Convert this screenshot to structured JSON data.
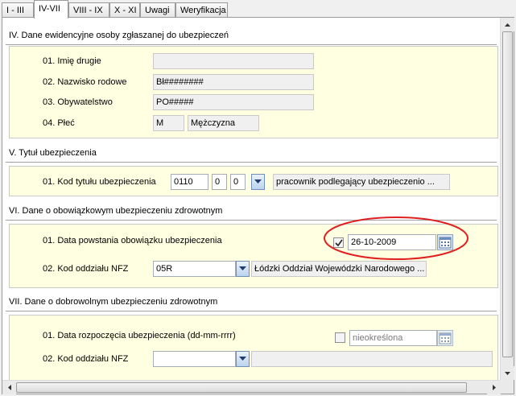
{
  "tabs": [
    "I - III",
    "IV-VII",
    "VIII - IX",
    "X - XI",
    "Uwagi",
    "Weryfikacja"
  ],
  "section4": {
    "title": "IV. Dane ewidencyjne osoby zgłaszanej do ubezpieczeń",
    "imie_label": "01. Imię drugie",
    "imie_value": "",
    "nazwisko_label": "02. Nazwisko rodowe",
    "nazwisko_value": "Bł########",
    "obyw_label": "03. Obywatelstwo",
    "obyw_value": "PO#####",
    "plec_label": "04. Płeć",
    "plec_code": "M",
    "plec_text": "Mężczyzna"
  },
  "section5": {
    "title": "V. Tytuł ubezpieczenia",
    "kod_label": "01. Kod tytułu ubezpieczenia",
    "kod1": "0110",
    "kod2": "0",
    "kod3": "0",
    "kod_desc": "pracownik podlegający ubezpieczenio ..."
  },
  "section6": {
    "title": "VI. Dane o obowiązkowym ubezpieczeniu zdrowotnym",
    "data_label": "01. Data powstania obowiązku ubezpieczenia",
    "data_checked": true,
    "data_value": "26-10-2009",
    "nfz_label": "02. Kod oddziału NFZ",
    "nfz_code": "05R",
    "nfz_desc": "Łódzki Oddział Wojewódzki Narodowego ..."
  },
  "section7": {
    "title": "VII. Dane o dobrowolnym ubezpieczeniu zdrowotnym",
    "data_label": "01. Data rozpoczęcia ubezpieczenia (dd-mm-rrrr)",
    "data_checked": false,
    "data_value": "nieokreślona",
    "nfz_label": "02. Kod oddziału NFZ",
    "nfz_code": "",
    "nfz_desc": ""
  },
  "annotation_color": "#e02020"
}
